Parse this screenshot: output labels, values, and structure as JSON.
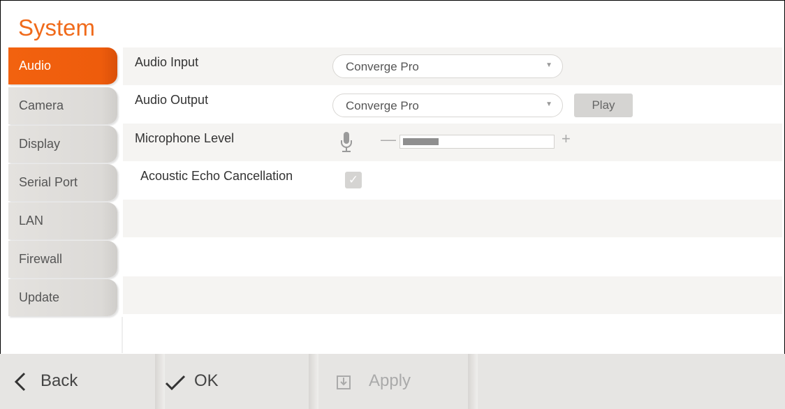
{
  "page": {
    "title": "System"
  },
  "sidebar": {
    "items": [
      {
        "label": "Audio",
        "active": true
      },
      {
        "label": "Camera",
        "active": false
      },
      {
        "label": "Display",
        "active": false
      },
      {
        "label": "Serial Port",
        "active": false
      },
      {
        "label": "LAN",
        "active": false
      },
      {
        "label": "Firewall",
        "active": false
      },
      {
        "label": "Update",
        "active": false
      }
    ]
  },
  "audio": {
    "input": {
      "label": "Audio Input",
      "value": "Converge Pro"
    },
    "output": {
      "label": "Audio Output",
      "value": "Converge Pro",
      "play_label": "Play"
    },
    "mic": {
      "label": "Microphone Level",
      "level_fraction": 0.24,
      "minus_glyph": "—",
      "plus_glyph": "+"
    },
    "aec": {
      "label": "Acoustic Echo Cancellation",
      "checked": true,
      "check_glyph": "✓"
    }
  },
  "footer": {
    "back_label": "Back",
    "ok_label": "OK",
    "apply_label": "Apply"
  },
  "colors": {
    "accent": "#f06a1a",
    "active_tab": "#ee5c0c"
  }
}
